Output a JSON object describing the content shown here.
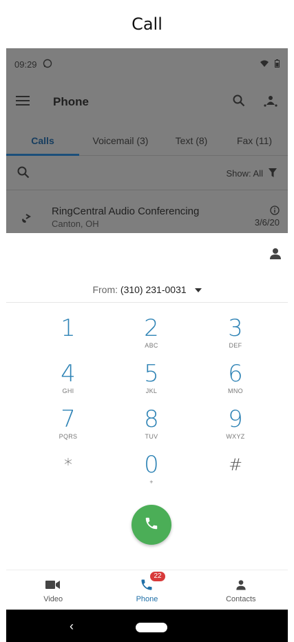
{
  "caption": "Call",
  "status_bar": {
    "time": "09:29"
  },
  "app_bar": {
    "title": "Phone"
  },
  "tabs": [
    {
      "label": "Calls",
      "active": true
    },
    {
      "label": "Voicemail (3)",
      "active": false
    },
    {
      "label": "Text (8)",
      "active": false
    },
    {
      "label": "Fax (11)",
      "active": false
    }
  ],
  "filter": {
    "show_label": "Show: All"
  },
  "call_row": {
    "name": "RingCentral Audio Conferencing",
    "location": "Canton, OH",
    "date": "3/6/20"
  },
  "dialer": {
    "from_label": "From:",
    "from_number": "(310) 231-0031",
    "keys": [
      {
        "digit": "1",
        "letters": ""
      },
      {
        "digit": "2",
        "letters": "ABC"
      },
      {
        "digit": "3",
        "letters": "DEF"
      },
      {
        "digit": "4",
        "letters": "GHI"
      },
      {
        "digit": "5",
        "letters": "JKL"
      },
      {
        "digit": "6",
        "letters": "MNO"
      },
      {
        "digit": "7",
        "letters": "PQRS"
      },
      {
        "digit": "8",
        "letters": "TUV"
      },
      {
        "digit": "9",
        "letters": "WXYZ"
      },
      {
        "digit": "*",
        "letters": ""
      },
      {
        "digit": "0",
        "letters": "+"
      },
      {
        "digit": "#",
        "letters": ""
      }
    ]
  },
  "bottom_nav": {
    "items": [
      {
        "label": "Video",
        "icon": "video-icon"
      },
      {
        "label": "Phone",
        "icon": "phone-icon",
        "badge": "22",
        "active": true
      },
      {
        "label": "Contacts",
        "icon": "contact-icon"
      }
    ]
  },
  "colors": {
    "accent": "#2e83b5",
    "call_green": "#4bae57",
    "badge_red": "#d83a3a",
    "active_tab": "#1b4f7a"
  }
}
